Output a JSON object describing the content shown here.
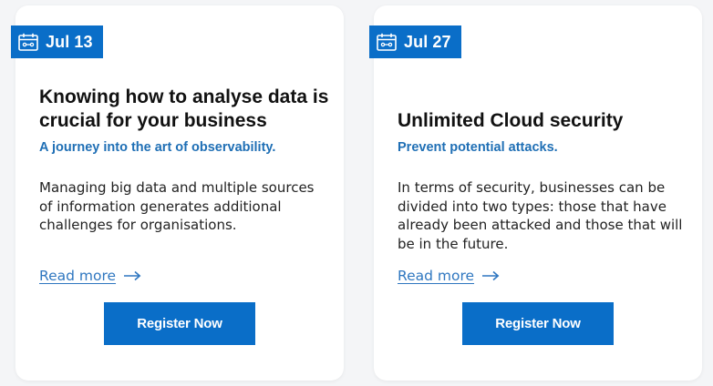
{
  "colors": {
    "accent": "#0a6ec8",
    "subtitle": "#1f6fb5",
    "link": "#2f77c0",
    "background": "#f4f5f7",
    "card": "#ffffff"
  },
  "cards": [
    {
      "date": "Jul 13",
      "date_icon": "calendar-icon",
      "title": "Knowing how to analyse data is crucial for your business",
      "subtitle": "A journey into the art of observability.",
      "description": "Managing big data and multiple sources of information generates additional challenges for organisations.",
      "read_more": "Read more",
      "read_more_icon": "arrow-right-icon",
      "button": "Register Now"
    },
    {
      "date": "Jul 27",
      "date_icon": "calendar-icon",
      "title": "Unlimited Cloud security",
      "subtitle": "Prevent potential attacks.",
      "description": "In terms of security, businesses can be divided into two types: those that have already been attacked and those that will be in the future.",
      "read_more": "Read more",
      "read_more_icon": "arrow-right-icon",
      "button": "Register Now"
    }
  ]
}
